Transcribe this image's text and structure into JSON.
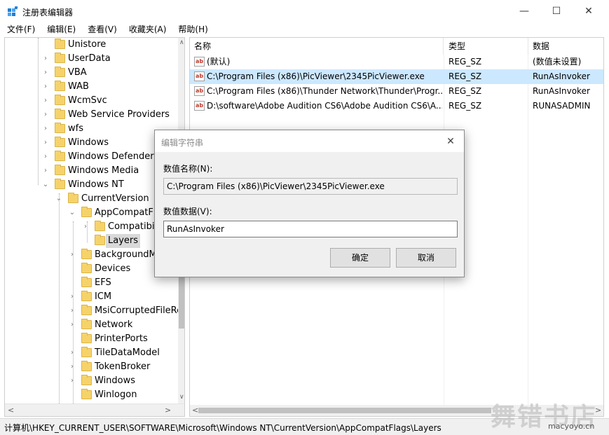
{
  "window": {
    "title": "注册表编辑器",
    "controls": {
      "minimize": "—",
      "maximize": "☐",
      "close": "✕"
    }
  },
  "menu": [
    "文件(F)",
    "编辑(E)",
    "查看(V)",
    "收藏夹(A)",
    "帮助(H)"
  ],
  "tree": {
    "items": [
      {
        "label": "Unistore",
        "expander": ""
      },
      {
        "label": "UserData",
        "expander": "›"
      },
      {
        "label": "VBA",
        "expander": "›"
      },
      {
        "label": "WAB",
        "expander": "›"
      },
      {
        "label": "WcmSvc",
        "expander": "›"
      },
      {
        "label": "Web Service Providers",
        "expander": "›"
      },
      {
        "label": "wfs",
        "expander": "›"
      },
      {
        "label": "Windows",
        "expander": "›"
      },
      {
        "label": "Windows Defender",
        "expander": "›"
      },
      {
        "label": "Windows Media",
        "expander": "›"
      },
      {
        "label": "Windows NT",
        "expander": "⌄"
      },
      {
        "label": "CurrentVersion",
        "expander": "⌄"
      },
      {
        "label": "AppCompatFlags",
        "expander": "⌄"
      },
      {
        "label": "Compatibility",
        "expander": "›"
      },
      {
        "label": "Layers",
        "expander": ""
      },
      {
        "label": "BackgroundModel",
        "expander": "›"
      },
      {
        "label": "Devices",
        "expander": ""
      },
      {
        "label": "EFS",
        "expander": ""
      },
      {
        "label": "ICM",
        "expander": "›"
      },
      {
        "label": "MsiCorruptedFileRecovery",
        "expander": "›"
      },
      {
        "label": "Network",
        "expander": "›"
      },
      {
        "label": "PrinterPorts",
        "expander": ""
      },
      {
        "label": "TileDataModel",
        "expander": "›"
      },
      {
        "label": "TokenBroker",
        "expander": "›"
      },
      {
        "label": "Windows",
        "expander": "›"
      },
      {
        "label": "Winlogon",
        "expander": ""
      }
    ],
    "scroll": {
      "up": "∧",
      "down": "∨",
      "left": "<",
      "right": ">"
    }
  },
  "list": {
    "columns": {
      "name": "名称",
      "type": "类型",
      "data": "数据"
    },
    "icon_text": "ab",
    "rows": [
      {
        "name": "(默认)",
        "type": "REG_SZ",
        "data": "(数值未设置)"
      },
      {
        "name": "C:\\Program Files (x86)\\PicViewer\\2345PicViewer.exe",
        "type": "REG_SZ",
        "data": "RunAsInvoker"
      },
      {
        "name": "C:\\Program Files (x86)\\Thunder Network\\Thunder\\Progr...",
        "type": "REG_SZ",
        "data": "RunAsInvoker"
      },
      {
        "name": "D:\\software\\Adobe Audition CS6\\Adobe Audition CS6\\A...",
        "type": "REG_SZ",
        "data": "RUNASADMIN"
      }
    ],
    "scroll": {
      "left": "<",
      "right": ">"
    }
  },
  "status": {
    "path": "计算机\\HKEY_CURRENT_USER\\SOFTWARE\\Microsoft\\Windows NT\\CurrentVersion\\AppCompatFlags\\Layers"
  },
  "watermark": {
    "text": "舞错书店",
    "url": "macyoyo.cn"
  },
  "dialog": {
    "title": "编辑字符串",
    "close": "✕",
    "name_label": "数值名称(N):",
    "name_value": "C:\\Program Files (x86)\\PicViewer\\2345PicViewer.exe",
    "data_label": "数值数据(V):",
    "data_value": "RunAsInvoker",
    "ok": "确定",
    "cancel": "取消"
  },
  "colors": {
    "selection": "#cce8ff",
    "folder": "#f6d36a",
    "dialog_bg": "#f0f0f0"
  }
}
